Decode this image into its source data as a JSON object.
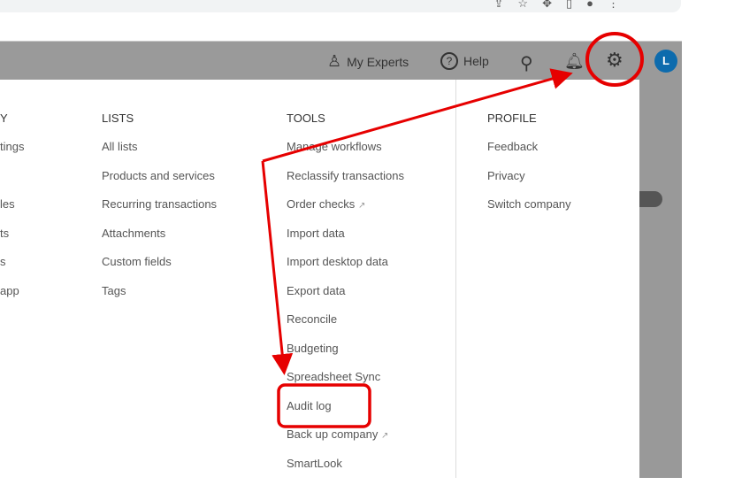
{
  "header": {
    "my_experts": "My Experts",
    "help": "Help",
    "avatar": "L"
  },
  "menu": {
    "company": {
      "heading": "Y",
      "items": [
        "tings",
        "",
        "les",
        "ts",
        "s",
        " app"
      ]
    },
    "lists": {
      "heading": "LISTS",
      "items": [
        "All lists",
        "Products and services",
        "Recurring transactions",
        "Attachments",
        "Custom fields",
        "Tags"
      ]
    },
    "tools": {
      "heading": "TOOLS",
      "items": [
        "Manage workflows",
        "Reclassify transactions",
        "Order checks",
        "Import data",
        "Import desktop data",
        "Export data",
        "Reconcile",
        "Budgeting",
        "Spreadsheet Sync",
        "Audit log",
        "Back up company",
        "SmartLook"
      ]
    },
    "profile": {
      "heading": "PROFILE",
      "items": [
        "Feedback",
        "Privacy",
        "Switch company"
      ]
    }
  },
  "colors": {
    "annotation": "#e60000",
    "header": "#9a9a9a",
    "avatar": "#0d6bad"
  }
}
